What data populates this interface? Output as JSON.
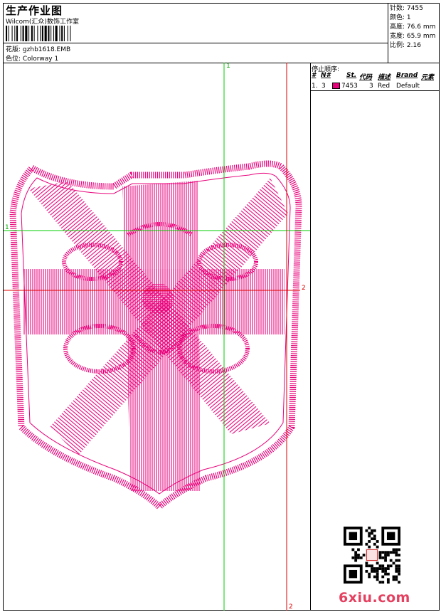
{
  "header": {
    "title": "生产作业图",
    "company": "Wilcom(汇众)数饰工作室",
    "design_label": "花版:",
    "design_file": "gzhb1618.EMB",
    "colorway_label": "色位:",
    "colorway": "Colorway 1"
  },
  "stats": [
    {
      "label": "针数:",
      "value": "7455"
    },
    {
      "label": "颜色:",
      "value": "1"
    },
    {
      "label": "高度:",
      "value": "76.6 mm"
    },
    {
      "label": "宽度:",
      "value": "65.9 mm"
    },
    {
      "label": "比例:",
      "value": "2.16"
    }
  ],
  "stop_sequence": {
    "title": "停止顺序:",
    "headers": [
      "#",
      "N#",
      "St.",
      "代码",
      "描述",
      "Brand",
      "元素"
    ],
    "rows": [
      {
        "index": "1.",
        "n": "3",
        "color": "#e8007a",
        "st": "7453",
        "code": "3",
        "desc": "Red",
        "brand": "Default",
        "elements": ""
      }
    ]
  },
  "guides": {
    "green_top": "1",
    "green_left": "1",
    "red_right": "2",
    "red_bottom": "2"
  },
  "colors": {
    "thread": "#e8007a",
    "guide_green": "#00cc00",
    "guide_red": "#e00000"
  },
  "watermark": "6xiu.com"
}
